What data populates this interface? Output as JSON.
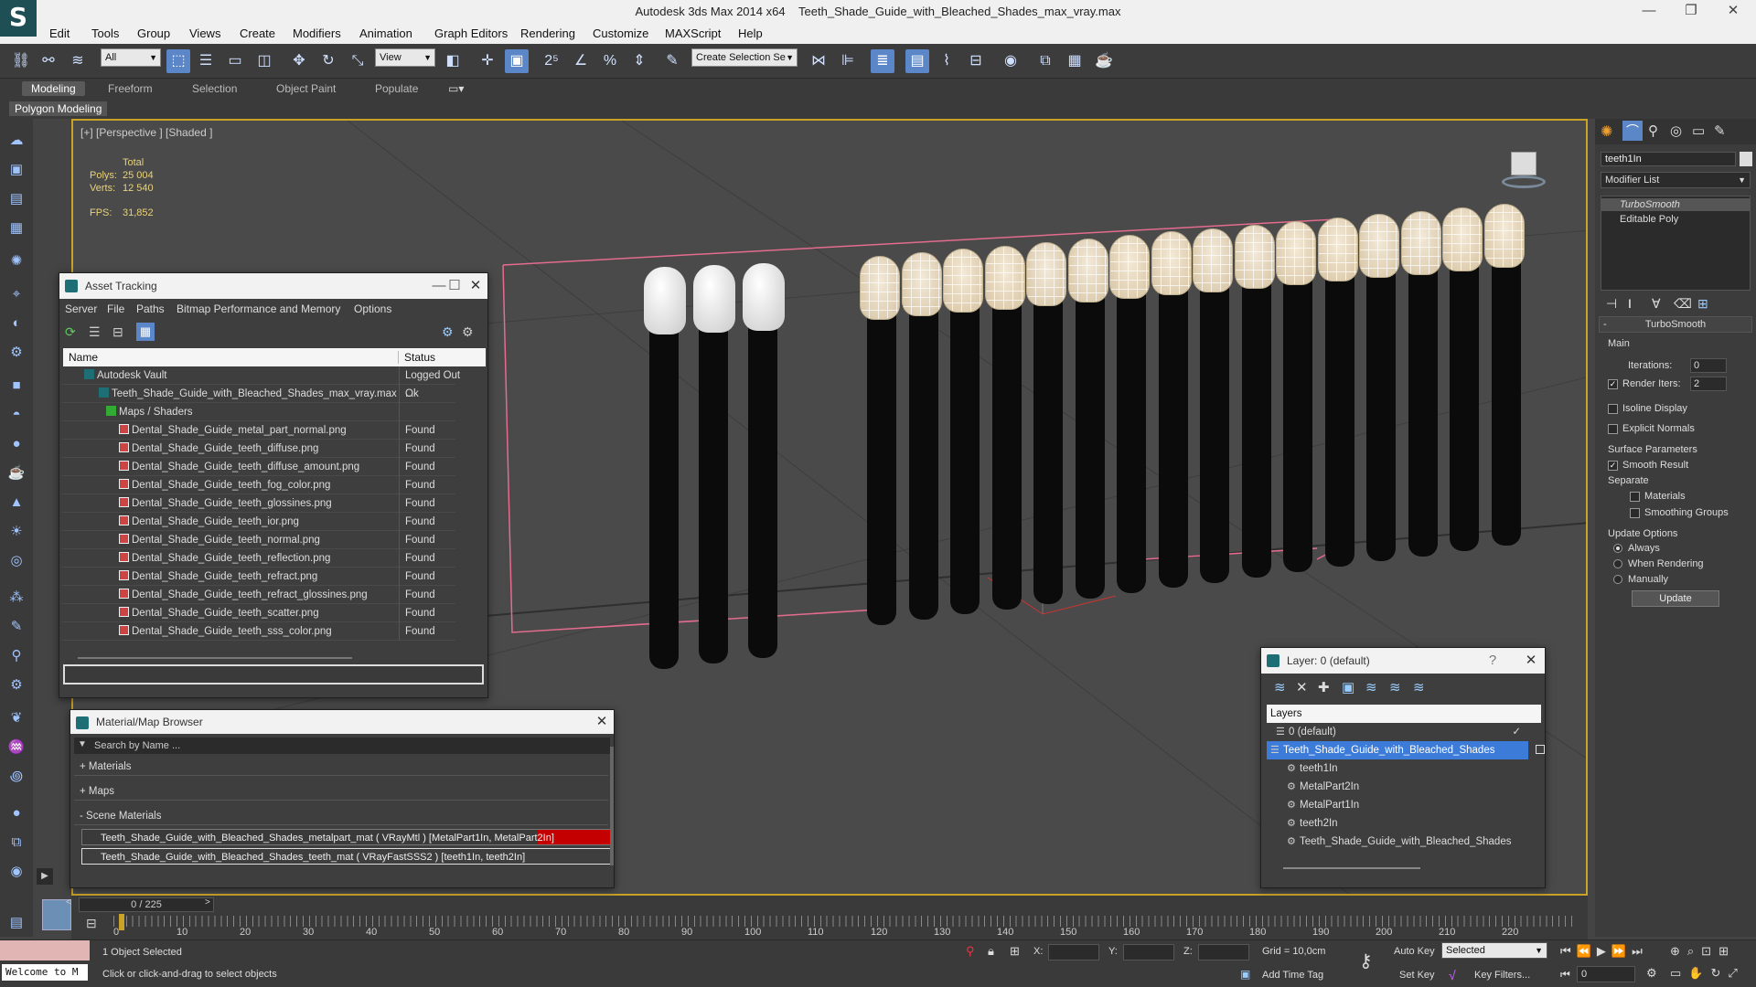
{
  "window": {
    "app": "Autodesk 3ds Max  2014 x64",
    "file": "Teeth_Shade_Guide_with_Bleached_Shades_max_vray.max"
  },
  "menu": [
    "Edit",
    "Tools",
    "Group",
    "Views",
    "Create",
    "Modifiers",
    "Animation",
    "Graph Editors",
    "Rendering",
    "Customize",
    "MAXScript",
    "Help"
  ],
  "toolbar": {
    "filter": "All",
    "ref_coord": "View",
    "selection_set": "Create Selection Se"
  },
  "ribbon": {
    "tabs": [
      "Modeling",
      "Freeform",
      "Selection",
      "Object Paint",
      "Populate"
    ],
    "sub_label": "Polygon Modeling"
  },
  "viewport": {
    "label": "[+] [Perspective ] [Shaded ]",
    "stats": {
      "total": "Total",
      "polys_label": "Polys:",
      "polys": "25 004",
      "verts_label": "Verts:",
      "verts": "12 540",
      "fps_label": "FPS:",
      "fps": "31,852"
    }
  },
  "asset_tracking": {
    "title": "Asset Tracking",
    "menu": [
      "Server",
      "File",
      "Paths",
      "Bitmap Performance and Memory",
      "Options"
    ],
    "col_name": "Name",
    "col_status": "Status",
    "rows": [
      {
        "name": "Autodesk Vault",
        "status": "Logged Out ..."
      },
      {
        "name": "Teeth_Shade_Guide_with_Bleached_Shades_max_vray.max",
        "status": "Ok"
      },
      {
        "name": "Maps / Shaders",
        "status": ""
      },
      {
        "name": "Dental_Shade_Guide_metal_part_normal.png",
        "status": "Found"
      },
      {
        "name": "Dental_Shade_Guide_teeth_diffuse.png",
        "status": "Found"
      },
      {
        "name": "Dental_Shade_Guide_teeth_diffuse_amount.png",
        "status": "Found"
      },
      {
        "name": "Dental_Shade_Guide_teeth_fog_color.png",
        "status": "Found"
      },
      {
        "name": "Dental_Shade_Guide_teeth_glossines.png",
        "status": "Found"
      },
      {
        "name": "Dental_Shade_Guide_teeth_ior.png",
        "status": "Found"
      },
      {
        "name": "Dental_Shade_Guide_teeth_normal.png",
        "status": "Found"
      },
      {
        "name": "Dental_Shade_Guide_teeth_reflection.png",
        "status": "Found"
      },
      {
        "name": "Dental_Shade_Guide_teeth_refract.png",
        "status": "Found"
      },
      {
        "name": "Dental_Shade_Guide_teeth_refract_glossines.png",
        "status": "Found"
      },
      {
        "name": "Dental_Shade_Guide_teeth_scatter.png",
        "status": "Found"
      },
      {
        "name": "Dental_Shade_Guide_teeth_sss_color.png",
        "status": "Found"
      }
    ]
  },
  "material_browser": {
    "title": "Material/Map Browser",
    "search_placeholder": "Search by Name ...",
    "sections": [
      "+ Materials",
      "+ Maps",
      "- Scene Materials"
    ],
    "materials": [
      "Teeth_Shade_Guide_with_Bleached_Shades_metalpart_mat  ( VRayMtl )  [MetalPart1In, MetalPart2In]",
      "Teeth_Shade_Guide_with_Bleached_Shades_teeth_mat  ( VRayFastSSS2 )  [teeth1In, teeth2In]"
    ]
  },
  "layer_window": {
    "title": "Layer: 0 (default)",
    "help": "?",
    "header": "Layers",
    "rows": [
      "0 (default)",
      "Teeth_Shade_Guide_with_Bleached_Shades",
      "teeth1In",
      "MetalPart2In",
      "MetalPart1In",
      "teeth2In",
      "Teeth_Shade_Guide_with_Bleached_Shades"
    ]
  },
  "command_panel": {
    "object_name": "teeth1In",
    "modifier_list": "Modifier List",
    "stack": [
      "TurboSmooth",
      "Editable Poly"
    ],
    "rollout": "TurboSmooth",
    "main": "Main",
    "iterations_label": "Iterations:",
    "iterations": "0",
    "render_iters_label": "Render Iters:",
    "render_iters": "2",
    "isoline": "Isoline Display",
    "explicit": "Explicit Normals",
    "surface_params": "Surface Parameters",
    "smooth_result": "Smooth Result",
    "separate": "Separate",
    "materials": "Materials",
    "smoothing_groups": "Smoothing Groups",
    "update_options": "Update Options",
    "always": "Always",
    "when_rendering": "When Rendering",
    "manually": "Manually",
    "update": "Update"
  },
  "timeline": {
    "frame": "0 / 225",
    "ticks": [
      "0",
      "10",
      "20",
      "30",
      "40",
      "50",
      "60",
      "70",
      "80",
      "90",
      "100",
      "110",
      "120",
      "130",
      "140",
      "150",
      "160",
      "170",
      "180",
      "190",
      "200",
      "210",
      "220"
    ]
  },
  "status": {
    "welcome": "Welcome to M",
    "selected": "1 Object Selected",
    "prompt": "Click or click-and-drag to select objects",
    "x_label": "X:",
    "y_label": "Y:",
    "z_label": "Z:",
    "grid": "Grid = 10,0cm",
    "add_time_tag": "Add Time Tag",
    "auto_key": "Auto Key",
    "set_key": "Set Key",
    "selected_combo": "Selected",
    "key_filters": "Key Filters...",
    "frame_field": "0"
  }
}
